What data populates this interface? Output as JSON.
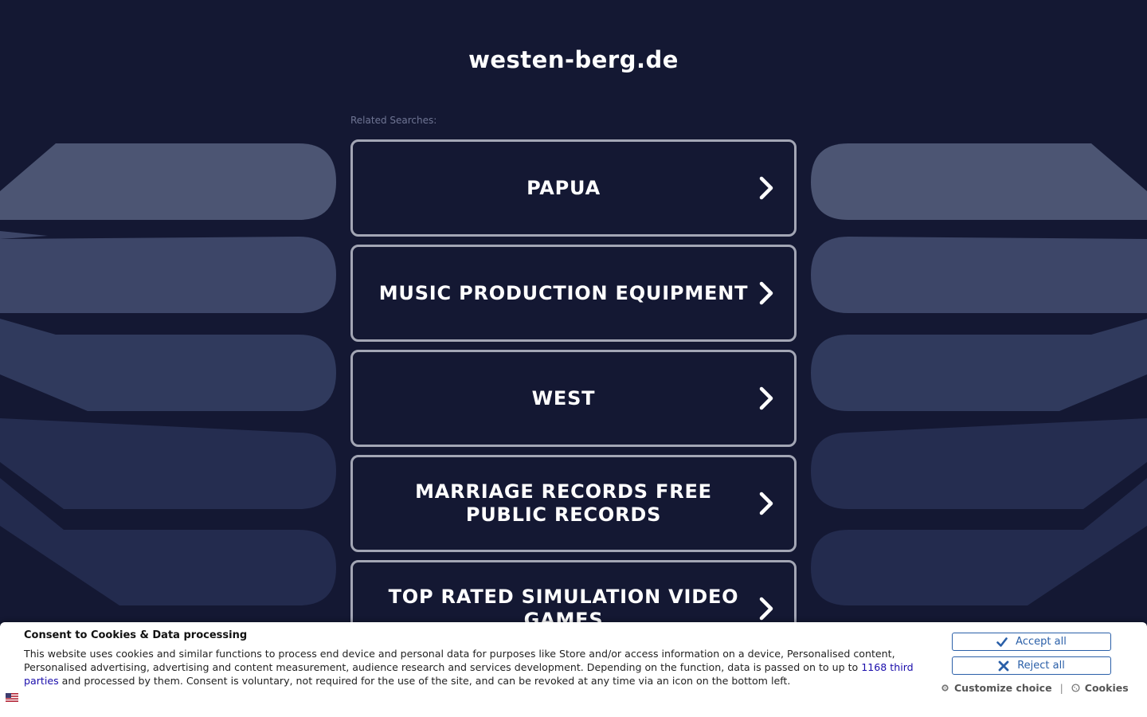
{
  "site": {
    "title": "westen-berg.de",
    "related_label": "Related Searches:"
  },
  "links": [
    {
      "label": "PAPUA"
    },
    {
      "label": "MUSIC PRODUCTION EQUIPMENT"
    },
    {
      "label": "WEST"
    },
    {
      "label": "MARRIAGE RECORDS FREE PUBLIC RECORDS"
    },
    {
      "label": "TOP RATED SIMULATION VIDEO GAMES"
    }
  ],
  "consent": {
    "title": "Consent to Cookies & Data processing",
    "text_part1": "This website uses cookies and similar functions to process end device and personal data for purposes like Store and/or access information on a device, Personalised content, Personalised advertising, advertising and content measurement, audience research and services development. Depending on the function, data is passed on to up to ",
    "third_parties_link": "1168 third parties",
    "text_part2": " and processed by them. Consent is voluntary, not required for the use of the site, and can be revoked at any time via an icon on the bottom left.",
    "accept_label": "Accept all",
    "reject_label": "Reject all",
    "customize_label": "Customize choice",
    "separator": "|",
    "cookies_label": "Cookies"
  },
  "colors": {
    "background": "#141833",
    "link_border": "#a3a6b5",
    "button_blue": "#2a5fa8"
  },
  "icons": [
    "chevron-right-icon",
    "check-icon",
    "close-icon",
    "gear-icon",
    "cookie-icon",
    "flag-icon"
  ]
}
